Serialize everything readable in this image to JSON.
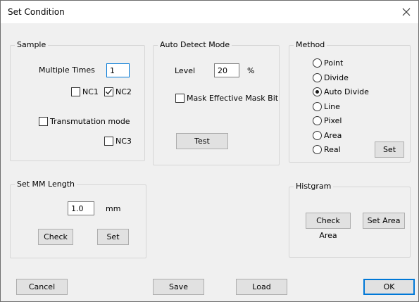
{
  "dialog": {
    "title": "Set Condition"
  },
  "sample": {
    "legend": "Sample",
    "multiple_times_label": "Multiple Times",
    "multiple_times_value": "1",
    "nc1_label": "NC1",
    "nc1_checked": false,
    "nc2_label": "NC2",
    "nc2_checked": true,
    "transmutation_label": "Transmutation mode",
    "transmutation_checked": false,
    "nc3_label": "NC3",
    "nc3_checked": false
  },
  "auto_detect": {
    "legend": "Auto Detect Mode",
    "level_label": "Level",
    "level_value": "20",
    "level_unit": "%",
    "mask_label": "Mask Effective Mask Bit",
    "mask_checked": false,
    "test_label": "Test"
  },
  "method": {
    "legend": "Method",
    "options": [
      "Point",
      "Divide",
      "Auto Divide",
      "Line",
      "Pixel",
      "Area",
      "Real"
    ],
    "selected": "Auto Divide",
    "set_label": "Set"
  },
  "mm_length": {
    "legend": "Set MM Length",
    "value": "1.0",
    "unit": "mm",
    "check_label": "Check",
    "set_label": "Set"
  },
  "histgram": {
    "legend": "Histgram",
    "check_area_label": "Check Area",
    "set_area_label": "Set Area"
  },
  "footer": {
    "cancel_label": "Cancel",
    "save_label": "Save",
    "load_label": "Load",
    "ok_label": "OK"
  }
}
